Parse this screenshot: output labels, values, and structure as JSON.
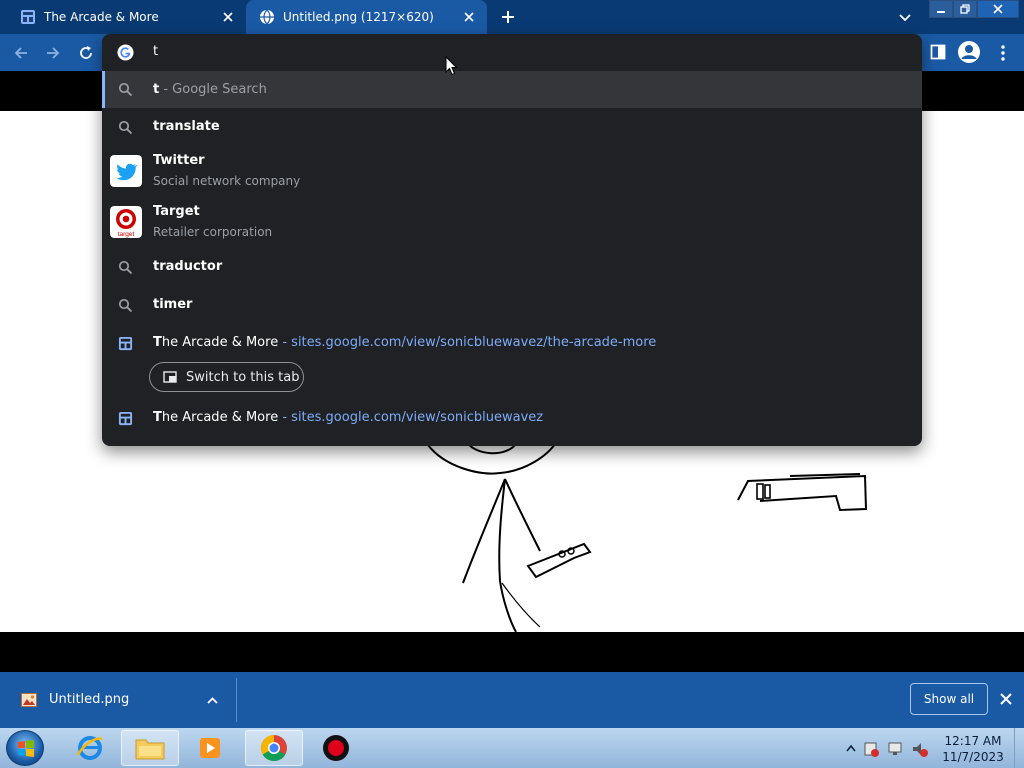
{
  "tabs": [
    {
      "title": "The Arcade & More",
      "active": false
    },
    {
      "title": "Untitled.png (1217×620)",
      "active": true
    }
  ],
  "omnibox": {
    "input_value": "t",
    "suggestions": [
      {
        "bold": "t",
        "rest": " - Google Search",
        "type": "search",
        "icon": "search-icon",
        "selected": true
      },
      {
        "bold": "t",
        "rest": "ranslate",
        "type": "search",
        "icon": "search-icon"
      },
      {
        "bold": "T",
        "rest": "witter",
        "sub": "Social network company",
        "type": "entity",
        "icon": "twitter-logo-icon"
      },
      {
        "bold": "T",
        "rest": "arget",
        "sub": "Retailer corporation",
        "type": "entity",
        "icon": "target-logo-icon"
      },
      {
        "bold": "t",
        "rest": "raductor",
        "type": "search",
        "icon": "search-icon"
      },
      {
        "bold": "t",
        "rest": "imer",
        "type": "search",
        "icon": "search-icon"
      },
      {
        "bold": "T",
        "rest": "he Arcade & More",
        "url_before": "sites.google.com/view/sonicbluewavez/",
        "url_bold": "t",
        "url_after": "he-arcade-more",
        "type": "tab",
        "icon": "google-sites-icon"
      },
      {
        "bold": "T",
        "rest": "he Arcade & More",
        "url_before": "sites.google.com/view/sonicbluewavez",
        "type": "history",
        "icon": "google-sites-icon"
      }
    ],
    "switch_tab_label": "Switch to this tab",
    "url_separator": " - "
  },
  "target_logo_text": "target",
  "download": {
    "filename": "Untitled.png",
    "show_all_label": "Show all"
  },
  "taskbar": {
    "time": "12:17 AM",
    "date": "11/7/2023",
    "apps": [
      "internet-explorer-icon",
      "file-explorer-icon",
      "media-player-icon",
      "chrome-icon",
      "recorder-icon"
    ]
  },
  "colors": {
    "chrome_frame": "#0a3a74",
    "toolbar": "#1a5aa5",
    "dropdown_bg": "#202124",
    "url_text": "#7cacf8"
  }
}
